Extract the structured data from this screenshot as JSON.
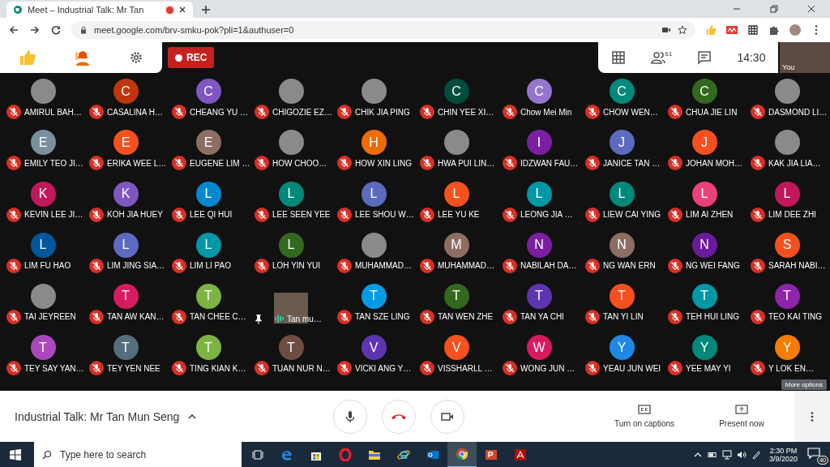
{
  "browser": {
    "tab_title": "Meet – Industrial Talk: Mr Tan",
    "recording": true,
    "url": "meet.google.com/brv-smku-pok?pli=1&authuser=0"
  },
  "top_bar": {
    "rec_label": "REC",
    "people_count": "61",
    "time": "14:30",
    "self_label": "You"
  },
  "tiles": [
    {
      "name": "AMIRUL BAH…",
      "kind": "photo",
      "muted": true
    },
    {
      "name": "CASALINA H…",
      "kind": "letter",
      "letter": "C",
      "color": "#bf360c",
      "muted": true
    },
    {
      "name": "CHEANG YU …",
      "kind": "letter",
      "letter": "C",
      "color": "#7e57c2",
      "muted": true
    },
    {
      "name": "CHIGOZIE EZ…",
      "kind": "photo",
      "muted": true
    },
    {
      "name": "CHIK JIA PING",
      "kind": "photo",
      "muted": true
    },
    {
      "name": "CHIN YEE XI…",
      "kind": "letter",
      "letter": "C",
      "color": "#004d40",
      "muted": true
    },
    {
      "name": "Chow Mei Min",
      "kind": "letter",
      "letter": "C",
      "color": "#9575cd",
      "muted": true
    },
    {
      "name": "CHOW WEN…",
      "kind": "letter",
      "letter": "C",
      "color": "#00897b",
      "muted": true
    },
    {
      "name": "CHUA JIE LIN",
      "kind": "letter",
      "letter": "C",
      "color": "#33691e",
      "muted": true
    },
    {
      "name": "DASMOND LI…",
      "kind": "photo",
      "muted": true
    },
    {
      "name": "EMILY TEO JI…",
      "kind": "letter",
      "letter": "E",
      "color": "#78909c",
      "muted": true
    },
    {
      "name": "ERIKA WEE L…",
      "kind": "letter",
      "letter": "E",
      "color": "#f4511e",
      "muted": true
    },
    {
      "name": "EUGENE LIM …",
      "kind": "letter",
      "letter": "E",
      "color": "#8d6e63",
      "muted": true
    },
    {
      "name": "HOW CHOO…",
      "kind": "photo",
      "muted": true
    },
    {
      "name": "HOW XIN LING",
      "kind": "letter",
      "letter": "H",
      "color": "#ef6c00",
      "muted": true
    },
    {
      "name": "HWA PUI LIN…",
      "kind": "photo",
      "muted": true
    },
    {
      "name": "IDZWAN FAU…",
      "kind": "letter",
      "letter": "I",
      "color": "#7b1fa2",
      "muted": true
    },
    {
      "name": "JANICE TAN …",
      "kind": "letter",
      "letter": "J",
      "color": "#5c6bc0",
      "muted": true
    },
    {
      "name": "JOHAN MOH…",
      "kind": "letter",
      "letter": "J",
      "color": "#f4511e",
      "muted": true
    },
    {
      "name": "KAK JIA LIA…",
      "kind": "photo",
      "muted": true
    },
    {
      "name": "KEVIN LEE JI…",
      "kind": "letter",
      "letter": "K",
      "color": "#c2185b",
      "muted": true
    },
    {
      "name": "KOH JIA HUEY",
      "kind": "letter",
      "letter": "K",
      "color": "#7e57c2",
      "muted": true
    },
    {
      "name": "LEE QI HUI",
      "kind": "letter",
      "letter": "L",
      "color": "#0288d1",
      "muted": true
    },
    {
      "name": "LEE SEEN YEE",
      "kind": "letter",
      "letter": "L",
      "color": "#00897b",
      "muted": true
    },
    {
      "name": "LEE SHOU W…",
      "kind": "letter",
      "letter": "L",
      "color": "#5c6bc0",
      "muted": true
    },
    {
      "name": "LEE YU KE",
      "kind": "letter",
      "letter": "L",
      "color": "#f4511e",
      "muted": true
    },
    {
      "name": "LEONG JIA …",
      "kind": "letter",
      "letter": "L",
      "color": "#0097a7",
      "muted": true
    },
    {
      "name": "LIEW CAI YING",
      "kind": "letter",
      "letter": "L",
      "color": "#00897b",
      "muted": true
    },
    {
      "name": "LIM AI ZHEN",
      "kind": "letter",
      "letter": "L",
      "color": "#ec407a",
      "muted": true
    },
    {
      "name": "LIM DEE ZHI",
      "kind": "letter",
      "letter": "L",
      "color": "#c2185b",
      "muted": true
    },
    {
      "name": "LIM FU HAO",
      "kind": "letter",
      "letter": "L",
      "color": "#01579b",
      "muted": true
    },
    {
      "name": "LIM JING SIA…",
      "kind": "letter",
      "letter": "L",
      "color": "#5c6bc0",
      "muted": true
    },
    {
      "name": "LIM LI PAO",
      "kind": "letter",
      "letter": "L",
      "color": "#0097a7",
      "muted": true
    },
    {
      "name": "LOH YIN YUI",
      "kind": "letter",
      "letter": "L",
      "color": "#33691e",
      "muted": true
    },
    {
      "name": "MUHAMMAD…",
      "kind": "photo",
      "muted": true
    },
    {
      "name": "MUHAMMAD…",
      "kind": "letter",
      "letter": "M",
      "color": "#8d6e63",
      "muted": true
    },
    {
      "name": "NABILAH DA…",
      "kind": "letter",
      "letter": "N",
      "color": "#7b1fa2",
      "muted": true
    },
    {
      "name": "NG WAN ERN",
      "kind": "letter",
      "letter": "N",
      "color": "#8d6e63",
      "muted": true
    },
    {
      "name": "NG WEI FANG",
      "kind": "letter",
      "letter": "N",
      "color": "#6a1b9a",
      "muted": true
    },
    {
      "name": "SARAH NABI…",
      "kind": "letter",
      "letter": "S",
      "color": "#f4511e",
      "muted": true
    },
    {
      "name": "TAI JEYREEN",
      "kind": "photo",
      "muted": true
    },
    {
      "name": "TAN AW KAN…",
      "kind": "letter",
      "letter": "T",
      "color": "#d81b60",
      "muted": true
    },
    {
      "name": "TAN CHEE C…",
      "kind": "letter",
      "letter": "T",
      "color": "#7cb342",
      "muted": true
    },
    {
      "name": "Tan mu…",
      "kind": "video",
      "muted": false
    },
    {
      "name": "TAN SZE LING",
      "kind": "letter",
      "letter": "T",
      "color": "#039be5",
      "muted": true
    },
    {
      "name": "TAN WEN ZHE",
      "kind": "letter",
      "letter": "T",
      "color": "#33691e",
      "muted": true
    },
    {
      "name": "TAN YA CHI",
      "kind": "letter",
      "letter": "T",
      "color": "#5e35b1",
      "muted": true
    },
    {
      "name": "TAN YI LIN",
      "kind": "letter",
      "letter": "T",
      "color": "#f4511e",
      "muted": true
    },
    {
      "name": "TEH HUI LING",
      "kind": "letter",
      "letter": "T",
      "color": "#0097a7",
      "muted": true
    },
    {
      "name": "TEO KAI TING",
      "kind": "letter",
      "letter": "T",
      "color": "#8e24aa",
      "muted": true
    },
    {
      "name": "TEY SAY YAN…",
      "kind": "letter",
      "letter": "T",
      "color": "#ab47bc",
      "muted": true
    },
    {
      "name": "TEY YEN NEE",
      "kind": "letter",
      "letter": "T",
      "color": "#546e7a",
      "muted": true
    },
    {
      "name": "TING KIAN K…",
      "kind": "letter",
      "letter": "T",
      "color": "#7cb342",
      "muted": true
    },
    {
      "name": "TUAN NUR N…",
      "kind": "letter",
      "letter": "T",
      "color": "#6d4c41",
      "muted": true
    },
    {
      "name": "VICKI ANG Y…",
      "kind": "letter",
      "letter": "V",
      "color": "#5e35b1",
      "muted": true
    },
    {
      "name": "VISSHARLL …",
      "kind": "letter",
      "letter": "V",
      "color": "#f4511e",
      "muted": true
    },
    {
      "name": "WONG JUN …",
      "kind": "letter",
      "letter": "W",
      "color": "#d81b60",
      "muted": true
    },
    {
      "name": "YEAU JUN WEI",
      "kind": "letter",
      "letter": "Y",
      "color": "#1e88e5",
      "muted": true
    },
    {
      "name": "YEE MAY YI",
      "kind": "letter",
      "letter": "Y",
      "color": "#00897b",
      "muted": true
    },
    {
      "name": "Y LOK EN…",
      "kind": "letter",
      "letter": "Y",
      "color": "#f57c00",
      "muted": true
    }
  ],
  "tooltip": "More options",
  "bottom_bar": {
    "meeting_title": "Industrial Talk: Mr Tan Mun Seng",
    "captions_label": "Turn on captions",
    "present_label": "Present now"
  },
  "taskbar": {
    "search_placeholder": "Type here to search",
    "time": "2:30 PM",
    "date": "3/9/2020",
    "notification_count": "40"
  }
}
